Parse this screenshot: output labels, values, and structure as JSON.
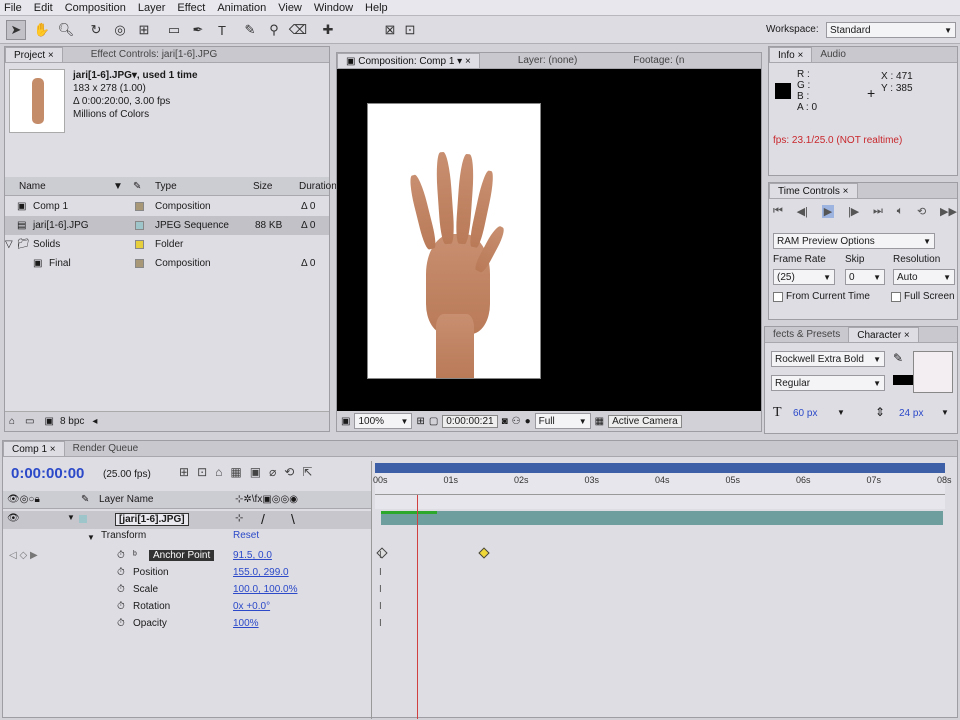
{
  "menu": [
    "File",
    "Edit",
    "Composition",
    "Layer",
    "Effect",
    "Animation",
    "View",
    "Window",
    "Help"
  ],
  "workspace": {
    "label": "Workspace:",
    "value": "Standard"
  },
  "project": {
    "tabs": [
      "Project",
      "Effect Controls: jari[1-6].JPG"
    ],
    "asset_name": "jari[1-6].JPG▾, used 1 time",
    "asset_dims": "183 x 278 (1.00)",
    "asset_duration": "Δ 0:00:20:00, 3.00 fps",
    "asset_colors": "Millions of Colors",
    "cols": [
      "Name",
      "Type",
      "Size",
      "Duration"
    ],
    "items": [
      {
        "name": "Comp 1",
        "type": "Composition",
        "size": "",
        "dur": "Δ 0",
        "color": "#a89878"
      },
      {
        "name": "jari[1-6].JPG",
        "type": "JPEG Sequence",
        "size": "88 KB",
        "dur": "Δ 0",
        "color": "#9ec5c9"
      },
      {
        "name": "Solids",
        "type": "Folder",
        "size": "",
        "dur": "",
        "color": "#e6cf3a"
      },
      {
        "name": "Final",
        "type": "Composition",
        "size": "",
        "dur": "Δ 0",
        "color": "#a89878"
      }
    ],
    "bpc": "8 bpc"
  },
  "comp": {
    "tabs": [
      "Composition: Comp 1",
      "Layer: (none)",
      "Footage: (n"
    ],
    "zoom": "100%",
    "timecode": "0:00:00:21",
    "resolution": "Full",
    "camera": "Active Camera"
  },
  "info": {
    "tabs": [
      "Info",
      "Audio"
    ],
    "r": "R :",
    "g": "G :",
    "b": "B :",
    "a": "A : 0",
    "x": "X : 471",
    "y": "Y : 385",
    "fps": "fps: 23.1/25.0 (NOT realtime)"
  },
  "time_controls": {
    "tab": "Time Controls",
    "ram": "RAM Preview Options",
    "frame_rate_label": "Frame Rate",
    "frame_rate": "(25)",
    "skip_label": "Skip",
    "skip": "0",
    "res_label": "Resolution",
    "res": "Auto",
    "from_current": "From Current Time",
    "full_screen": "Full Screen"
  },
  "character": {
    "tabs": [
      "fects & Presets",
      "Character"
    ],
    "font": "Rockwell Extra Bold",
    "style": "Regular",
    "size": "60 px",
    "leading": "24 px"
  },
  "timeline": {
    "tabs": [
      "Comp 1",
      "Render Queue"
    ],
    "time": "0:00:00:00",
    "fps": "(25.00 fps)",
    "col_layer": "Layer Name",
    "layer": "[jari[1-6].JPG]",
    "transform": "Transform",
    "reset": "Reset",
    "props": [
      {
        "name": "Anchor Point",
        "value": "91.5, 0.0"
      },
      {
        "name": "Position",
        "value": "155.0, 299.0"
      },
      {
        "name": "Scale",
        "value": "100.0, 100.0%"
      },
      {
        "name": "Rotation",
        "value": "0x +0.0°"
      },
      {
        "name": "Opacity",
        "value": "100%"
      }
    ],
    "ruler": [
      "00s",
      "01s",
      "02s",
      "03s",
      "04s",
      "05s",
      "06s",
      "07s",
      "08s"
    ]
  }
}
